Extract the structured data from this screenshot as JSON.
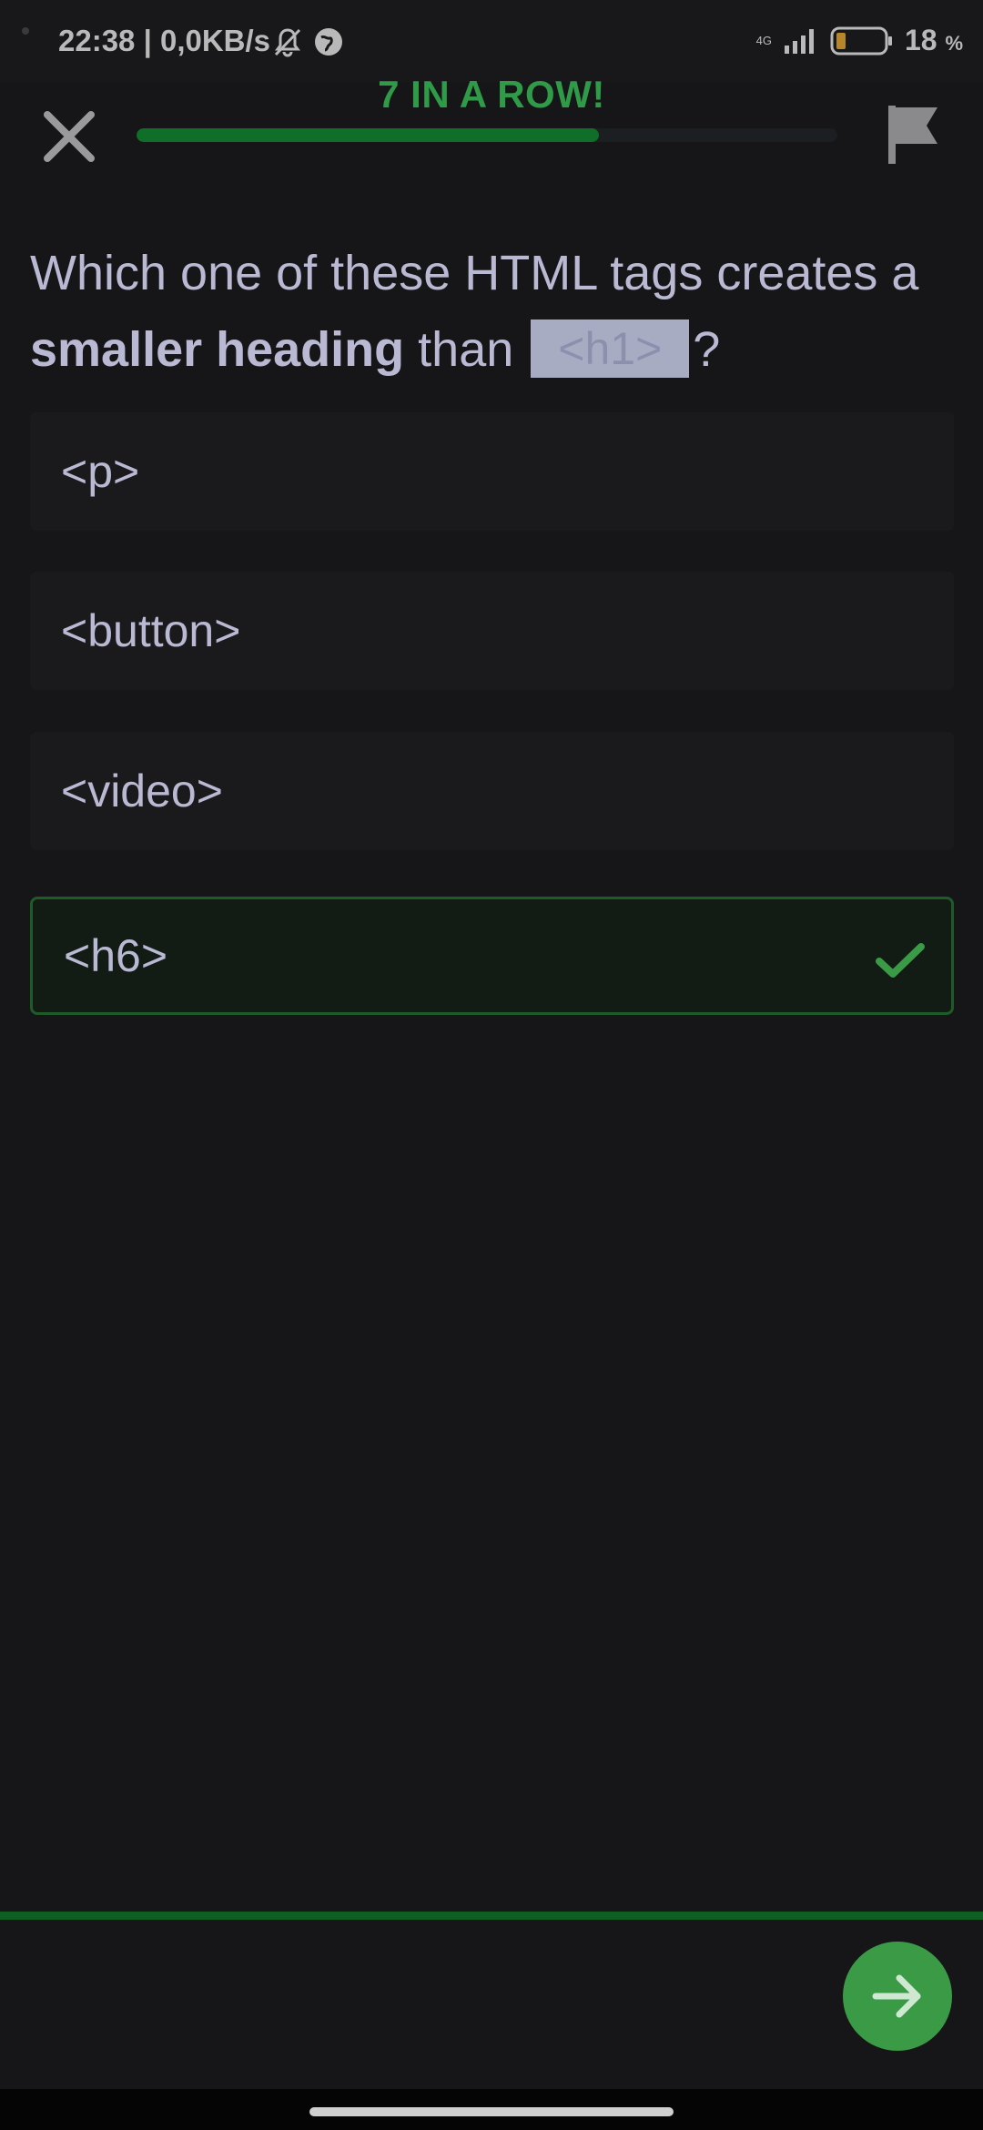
{
  "status_bar": {
    "time_speed": "22:38 | 0,0KB/s",
    "network": "4G",
    "battery": "18",
    "battery_unit": "%"
  },
  "header": {
    "streak": "7 IN A ROW!",
    "progress_fraction": 0.66
  },
  "question": {
    "part1": "Which one of these HTML tags creates a ",
    "bold": "smaller heading",
    "part2": " than ",
    "code": "<h1>",
    "part3": "?"
  },
  "options": [
    {
      "label": "<p>"
    },
    {
      "label": "<button>"
    },
    {
      "label": "<video>"
    },
    {
      "label": "<h6>",
      "state": "correct"
    }
  ],
  "colors": {
    "accent": "#2f9a47",
    "correct_border": "#1e5b28",
    "next_button": "#3a9a46",
    "background": "#161618"
  },
  "icons": {
    "close": "close-icon",
    "flag": "flag-icon",
    "check": "check-icon",
    "next": "arrow-right-icon"
  }
}
